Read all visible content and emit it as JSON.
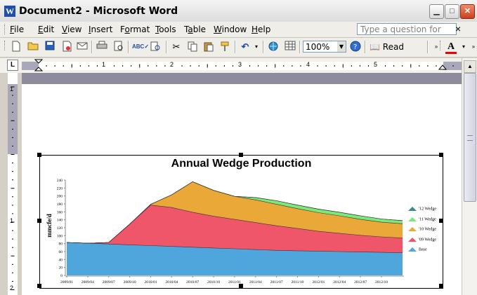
{
  "window": {
    "title": "Document2 - Microsoft Word",
    "app_icon": "W"
  },
  "menu": {
    "items": [
      {
        "pre": "",
        "ul": "F",
        "post": "ile"
      },
      {
        "pre": "",
        "ul": "E",
        "post": "dit"
      },
      {
        "pre": "",
        "ul": "V",
        "post": "iew"
      },
      {
        "pre": "",
        "ul": "I",
        "post": "nsert"
      },
      {
        "pre": "F",
        "ul": "o",
        "post": "rmat"
      },
      {
        "pre": "",
        "ul": "T",
        "post": "ools"
      },
      {
        "pre": "T",
        "ul": "a",
        "post": "ble"
      },
      {
        "pre": "",
        "ul": "W",
        "post": "indow"
      },
      {
        "pre": "",
        "ul": "H",
        "post": "elp"
      }
    ],
    "help_placeholder": "Type a question for help",
    "help_close": "×"
  },
  "toolbar": {
    "zoom": "100%",
    "read_label": "Read"
  },
  "ruler": {
    "h_numbers": [
      "1",
      "2",
      "3",
      "4",
      "5"
    ],
    "v_numbers": [
      "1",
      "1",
      "2"
    ]
  },
  "chart_data": {
    "type": "area",
    "title": "Annual Wedge Production",
    "ylabel": "mmcfe/d",
    "ylim": [
      0,
      240
    ],
    "yticks": [
      0,
      20,
      40,
      60,
      80,
      100,
      120,
      140,
      160,
      180,
      200,
      220,
      240
    ],
    "x_tick_labels": [
      "2009/01",
      "2009/04",
      "2009/07",
      "2009/10",
      "2010/01",
      "2010/04",
      "2010/07",
      "2010/10",
      "2011/01",
      "2011/04",
      "2011/07",
      "2011/10",
      "2012/01",
      "2012/04",
      "2012/07",
      "2012/10"
    ],
    "x": [
      "2009/01",
      "2009/04",
      "2009/07",
      "2009/10",
      "2010/01",
      "2010/04",
      "2010/07",
      "2010/10",
      "2011/01",
      "2011/04",
      "2011/07",
      "2011/10",
      "2012/01",
      "2012/04",
      "2012/07",
      "2012/10",
      "2012/12"
    ],
    "series": [
      {
        "name": "Base",
        "color": "#4ea6dc",
        "values": [
          83,
          81,
          79,
          77,
          75,
          73,
          71,
          69,
          67,
          65,
          63,
          62,
          61,
          60,
          59,
          58,
          57
        ]
      },
      {
        "name": "'09 Wedge",
        "color": "#f0566a",
        "values": [
          0,
          0,
          4,
          52,
          102,
          98,
          88,
          80,
          74,
          68,
          62,
          56,
          50,
          46,
          42,
          39,
          37
        ]
      },
      {
        "name": "'10 Wedge",
        "color": "#eaa838",
        "values": [
          0,
          0,
          0,
          0,
          2,
          32,
          77,
          65,
          58,
          57,
          54,
          50,
          47,
          44,
          40,
          37,
          36
        ]
      },
      {
        "name": "'11 Wedge",
        "color": "#7ce878",
        "values": [
          0,
          0,
          0,
          0,
          0,
          0,
          0,
          0,
          0,
          6,
          9,
          9,
          9,
          9,
          9,
          8,
          8
        ]
      },
      {
        "name": "'12 Wedge",
        "color": "#3a8a8a",
        "values": [
          0,
          0,
          0,
          0,
          0,
          0,
          0,
          0,
          0,
          0,
          0,
          0,
          0,
          0,
          0,
          0,
          0
        ]
      }
    ],
    "legend_position": "right",
    "grid": false
  }
}
